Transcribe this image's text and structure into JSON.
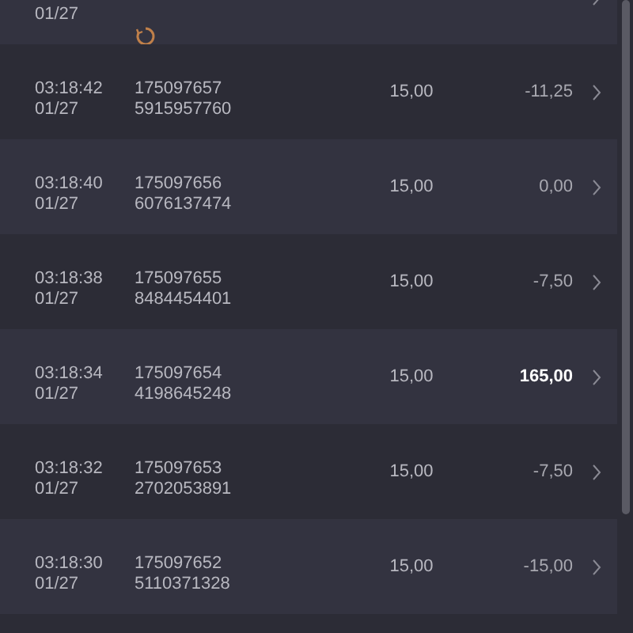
{
  "rows": [
    {
      "date": "01/27",
      "pending": true
    },
    {
      "time": "03:18:42",
      "date": "01/27",
      "order": "175097657",
      "ticket": "5915957760",
      "pending": false,
      "volume": "15,00",
      "profit": "-11,25",
      "emphasized": false
    },
    {
      "time": "03:18:40",
      "date": "01/27",
      "order": "175097656",
      "ticket": "6076137474",
      "pending": false,
      "volume": "15,00",
      "profit": "0,00",
      "emphasized": false
    },
    {
      "time": "03:18:38",
      "date": "01/27",
      "order": "175097655",
      "ticket": "8484454401",
      "pending": false,
      "volume": "15,00",
      "profit": "-7,50",
      "emphasized": false
    },
    {
      "time": "03:18:34",
      "date": "01/27",
      "order": "175097654",
      "ticket": "4198645248",
      "pending": false,
      "volume": "15,00",
      "profit": "165,00",
      "emphasized": true
    },
    {
      "time": "03:18:32",
      "date": "01/27",
      "order": "175097653",
      "ticket": "2702053891",
      "pending": false,
      "volume": "15,00",
      "profit": "-7,50",
      "emphasized": false
    },
    {
      "time": "03:18:30",
      "date": "01/27",
      "order": "175097652",
      "ticket": "5110371328",
      "pending": false,
      "volume": "15,00",
      "profit": "-15,00",
      "emphasized": false
    }
  ]
}
